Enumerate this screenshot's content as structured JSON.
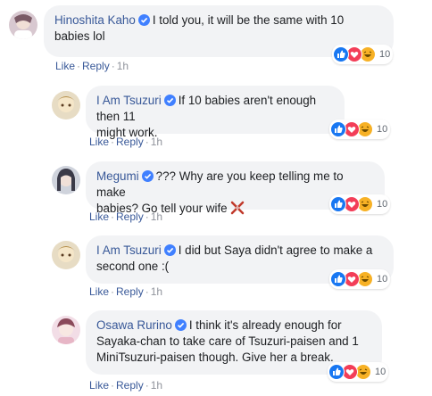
{
  "comments": [
    {
      "name": "Hinoshita Kaho",
      "text_line1": "I told you, it will be the same with 10",
      "text_line2": "babies lol",
      "like": "Like",
      "reply": "Reply",
      "time": "1h",
      "reaction_count": "10"
    },
    {
      "name": "I Am Tsuzuri",
      "text_line1": "If 10 babies aren't enough then 11",
      "text_line2": "might work.",
      "like": "Like",
      "reply": "Reply",
      "time": "1h",
      "reaction_count": "10"
    },
    {
      "name": "Megumi",
      "text_line1": "??? Why are you keep telling me to make",
      "text_line2": "babies? Go tell your wife",
      "like": "Like",
      "reply": "Reply",
      "time": "1h",
      "reaction_count": "10"
    },
    {
      "name": "I Am Tsuzuri",
      "text_line1": "I did but Saya didn't agree to make a",
      "text_line2": "second one :(",
      "like": "Like",
      "reply": "Reply",
      "time": "1h",
      "reaction_count": "10"
    },
    {
      "name": "Osawa Rurino",
      "text_line1": "I think it's already enough for",
      "text_line2": "Sayaka-chan to take care of Tsuzuri-paisen and 1",
      "text_line3": "MiniTsuzuri-paisen though. Give her a break.",
      "like": "Like",
      "reply": "Reply",
      "time": "1h",
      "reaction_count": "10"
    }
  ],
  "separator": "·",
  "colors": {
    "name": "#385898",
    "bubble": "#f2f3f5",
    "muted": "#90949c",
    "like": "#1877f2",
    "love": "#f33e58",
    "haha": "#f7b125"
  }
}
